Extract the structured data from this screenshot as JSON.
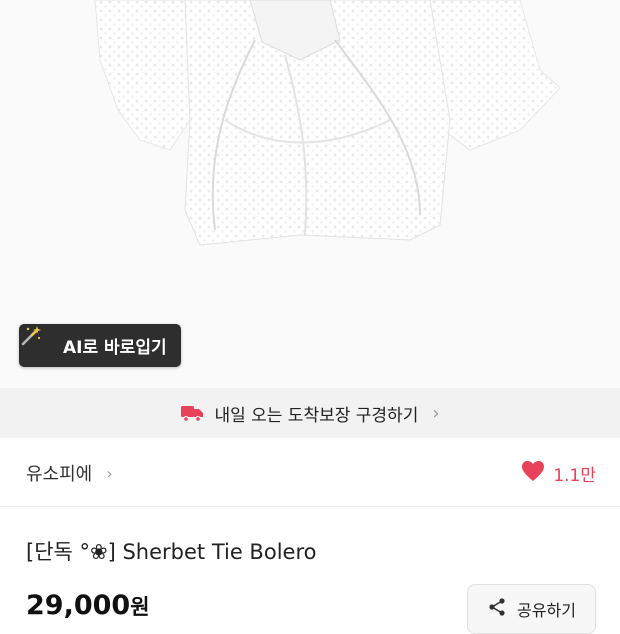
{
  "hero": {
    "ai_button_label": "AI로 바로입기"
  },
  "delivery_banner": {
    "text": "내일 오는 도착보장 구경하기",
    "chevron": "›"
  },
  "seller": {
    "name": "유소피에",
    "chevron": "›"
  },
  "likes": {
    "count": "1.1만"
  },
  "product": {
    "title": "[단독 °❀] Sherbet Tie Bolero",
    "price": "29,000",
    "currency": "원"
  },
  "share": {
    "label": "공유하기"
  },
  "icons": {
    "ai": "magic-wand-icon",
    "delivery": "delivery-truck-icon",
    "like": "heart-icon",
    "share": "share-icon"
  },
  "colors": {
    "accent": "#e8425a",
    "banner_bg": "#f2f2f2",
    "ai_button_bg": "#2e2e2e"
  }
}
